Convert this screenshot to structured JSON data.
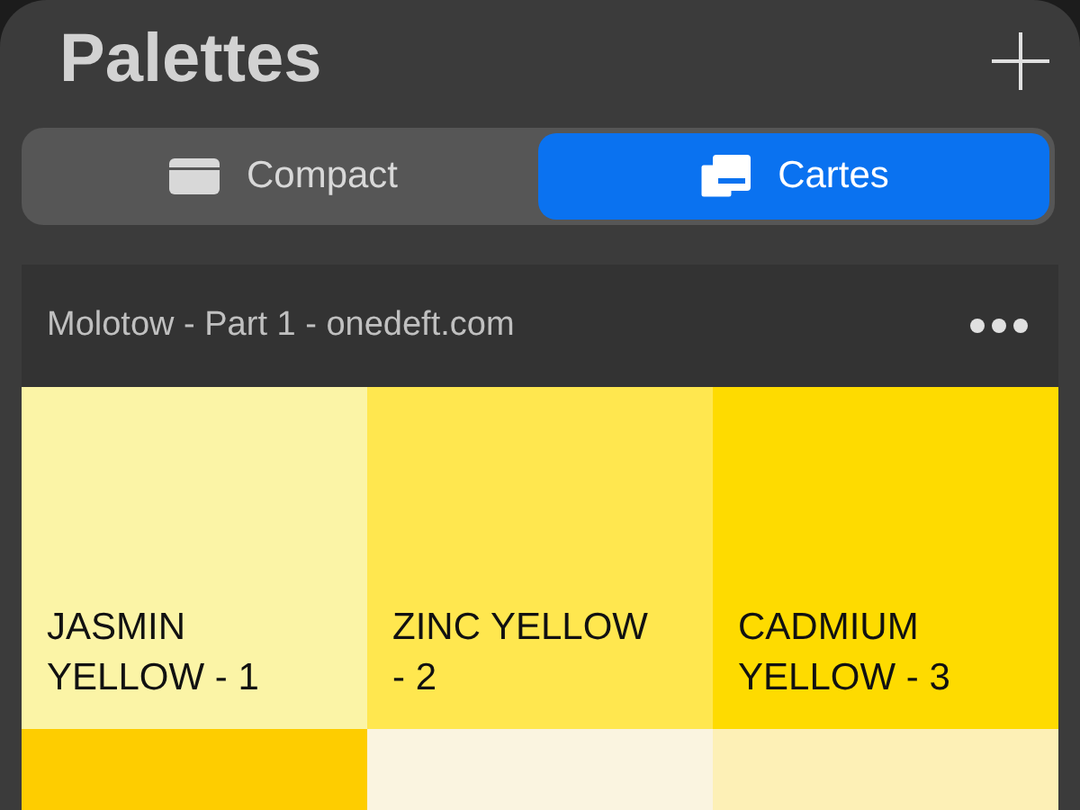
{
  "title": "Palettes",
  "view_switch": [
    {
      "label": "Compact",
      "kind": "compact",
      "selected": false
    },
    {
      "label": "Cartes",
      "kind": "cards",
      "selected": true
    }
  ],
  "palette": {
    "name": "Molotow - Part 1 - onedeft.com",
    "swatches": [
      {
        "name": "JASMIN\nYELLOW - 1",
        "color": "#fbf4a6"
      },
      {
        "name": "ZINC YELLOW\n- 2",
        "color": "#ffe74f"
      },
      {
        "name": "CADMIUM\nYELLOW - 3",
        "color": "#fedb00"
      },
      {
        "color": "#fecd00"
      },
      {
        "color": "#faf4e0"
      },
      {
        "color": "#fdf0b6"
      }
    ]
  }
}
